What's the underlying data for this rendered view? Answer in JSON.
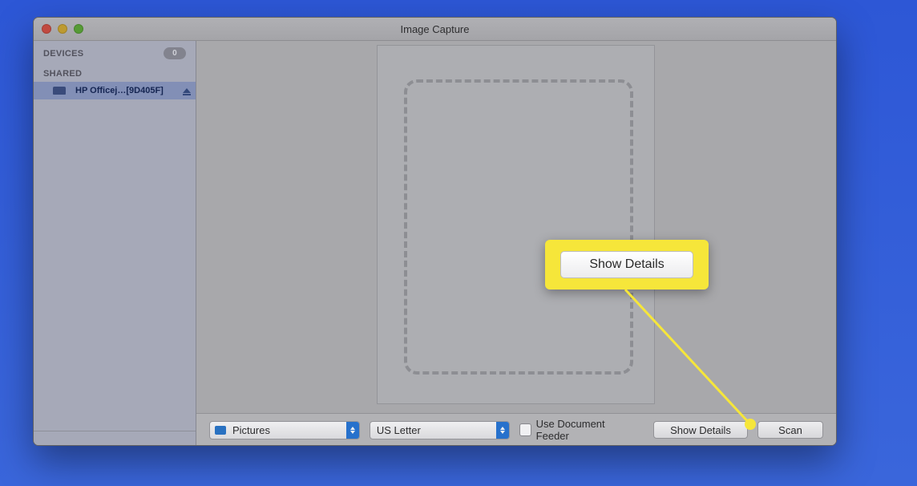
{
  "window": {
    "title": "Image Capture"
  },
  "sidebar": {
    "devices_label": "DEVICES",
    "devices_count": "0",
    "shared_label": "SHARED",
    "device_name": "HP Officej…[9D405F]"
  },
  "toolbar": {
    "destination": "Pictures",
    "paper_size": "US Letter",
    "feeder_label": "Use Document Feeder",
    "show_details_label": "Show Details",
    "scan_label": "Scan"
  },
  "callout": {
    "label": "Show Details"
  }
}
